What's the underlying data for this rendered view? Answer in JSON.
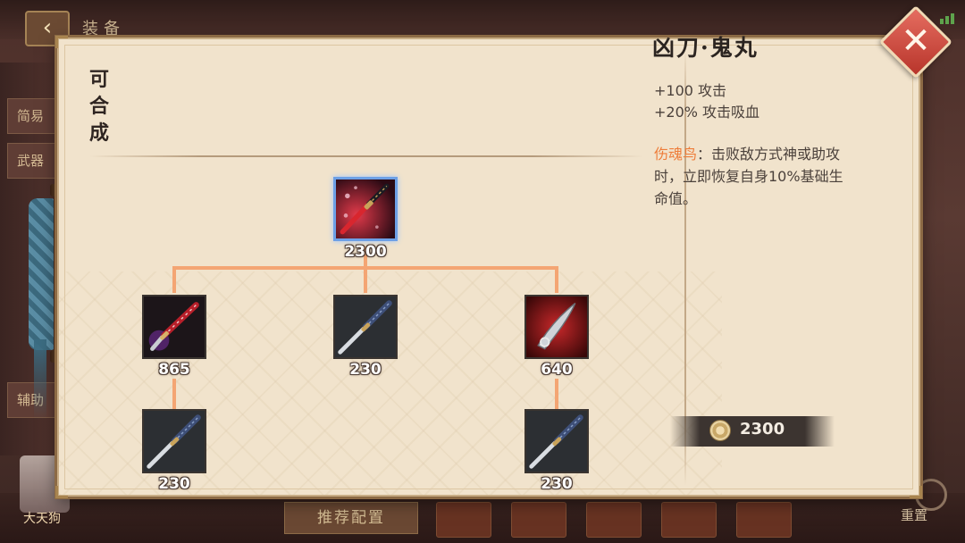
{
  "background": {
    "screen_title": "装备",
    "side_tabs": [
      "简易",
      "武器",
      "辅助"
    ],
    "hero_name": "大天狗",
    "recommend_label": "推荐配置",
    "reset_label": "重置"
  },
  "panel": {
    "section_title": "可合成",
    "tree": {
      "root": {
        "price": "2300",
        "icon": "cursed-katana-icon"
      },
      "children": [
        {
          "price": "865",
          "icon": "red-katana-icon"
        },
        {
          "price": "230",
          "icon": "katana-icon"
        },
        {
          "price": "640",
          "icon": "blood-blade-icon"
        }
      ],
      "grandchildren": [
        {
          "price": "230",
          "icon": "katana-icon"
        },
        {
          "price": "230",
          "icon": "katana-icon"
        }
      ]
    },
    "detail": {
      "name": "凶刀·鬼丸",
      "stats": [
        "+100 攻击",
        "+20% 攻击吸血"
      ],
      "passive_name": "伤魂鸟",
      "passive_desc": "：击败敌方式神或助攻时，立即恢复自身10%基础生命值。",
      "total_cost": "2300"
    },
    "close_icon": "close-icon"
  },
  "colors": {
    "connector": "#f4a573",
    "passive_highlight": "#ee7d3a",
    "close_button": "#d24a3e",
    "panel_bg": "#f1e3cc"
  }
}
